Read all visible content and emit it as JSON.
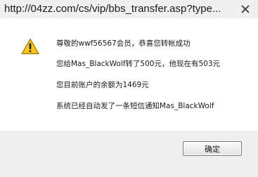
{
  "window": {
    "title": "http://04zz.com/cs/vip/bbs_transfer.asp?type..."
  },
  "message": {
    "lines": [
      "尊敬的wwf56567会员，恭喜您转帐成功",
      "您给Mas_BlackWolf转了500元，他现在有503元",
      "您目前账户的余额为1469元",
      "系统已经自动发了一条短信通知Mas_BlackWolf"
    ]
  },
  "buttons": {
    "ok_label": "确定"
  },
  "icons": {
    "alert": "warning-icon",
    "close": "close-icon"
  },
  "colors": {
    "warning_fill": "#f5c518",
    "warning_stroke": "#a07400"
  }
}
